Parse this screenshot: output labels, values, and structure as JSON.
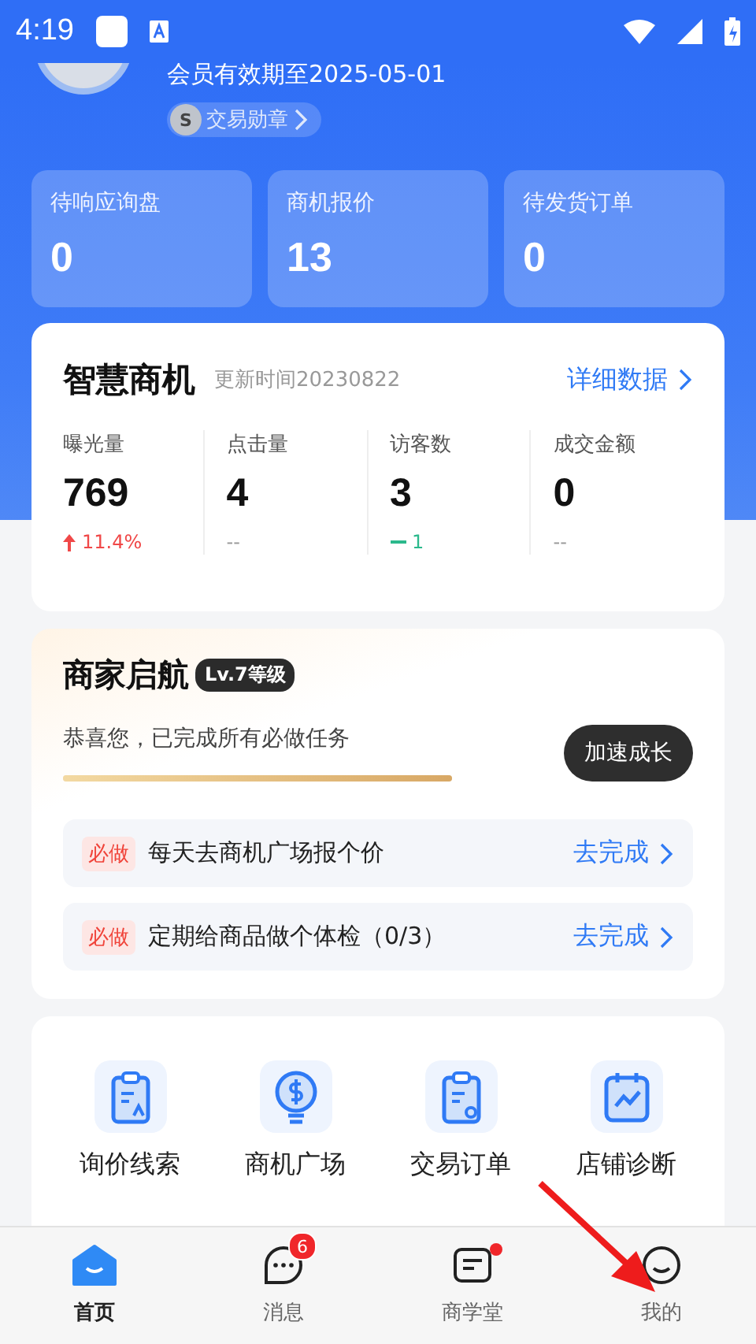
{
  "status_bar": {
    "time": "4:19"
  },
  "profile": {
    "membership": "会员有效期至2025-05-01",
    "badge": {
      "icon_letter": "S",
      "label": "交易勋章"
    }
  },
  "summary_cards": [
    {
      "label": "待响应询盘",
      "value": "0"
    },
    {
      "label": "商机报价",
      "value": "13"
    },
    {
      "label": "待发货订单",
      "value": "0"
    }
  ],
  "smart_business": {
    "title": "智慧商机",
    "updated": "更新时间20230822",
    "link": "详细数据",
    "metrics": [
      {
        "label": "曝光量",
        "value": "769",
        "kind": "up",
        "change": "11.4%"
      },
      {
        "label": "点击量",
        "value": "4",
        "kind": "none",
        "change": "--"
      },
      {
        "label": "访客数",
        "value": "3",
        "kind": "flat",
        "change": "1"
      },
      {
        "label": "成交金额",
        "value": "0",
        "kind": "none",
        "change": "--"
      }
    ]
  },
  "growth": {
    "title": "商家启航",
    "level_badge": "Lv.7等级",
    "message": "恭喜您，已完成所有必做任务",
    "level": 1,
    "button": "加速成长",
    "tasks": [
      {
        "tag": "必做",
        "text": "每天去商机广场报个价",
        "action": "去完成"
      },
      {
        "tag": "必做",
        "text": "定期给商品做个体检（0/3）",
        "action": "去完成"
      }
    ]
  },
  "tools": [
    {
      "kind": "clipboard-a",
      "label": "询价线索"
    },
    {
      "kind": "bulb",
      "label": "商机广场"
    },
    {
      "kind": "clipboard-gear",
      "label": "交易订单"
    },
    {
      "kind": "calendar-chart",
      "label": "店铺诊断"
    }
  ],
  "tab_bar": [
    {
      "kind": "home",
      "label": "首页",
      "selected": true
    },
    {
      "kind": "chat",
      "label": "消息",
      "selected": false,
      "badge": "6"
    },
    {
      "kind": "doc",
      "label": "商学堂",
      "selected": false,
      "dot": true
    },
    {
      "kind": "face",
      "label": "我的",
      "selected": false
    }
  ]
}
